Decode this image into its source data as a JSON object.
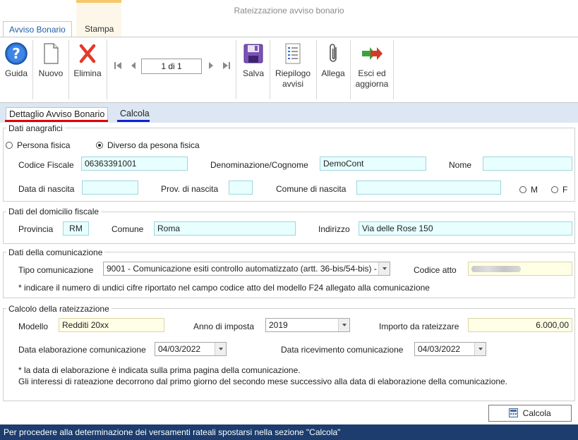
{
  "window": {
    "title": "Rateizzazione avviso bonario"
  },
  "ribbon": {
    "tabs": [
      {
        "label": "Avviso Bonario"
      },
      {
        "label": "Stampa"
      }
    ],
    "buttons": {
      "guida": "Guida",
      "nuovo": "Nuovo",
      "elimina": "Elimina",
      "salva": "Salva",
      "riepilogo_1": "Riepilogo",
      "riepilogo_2": "avvisi",
      "allega": "Allega",
      "esci_1": "Esci ed",
      "esci_2": "aggiorna"
    },
    "navigator": {
      "value": "1 di 1"
    }
  },
  "tabs": [
    {
      "label": "Dettaglio Avviso Bonario"
    },
    {
      "label": "Calcola"
    }
  ],
  "anagrafici": {
    "title": "Dati anagrafici",
    "radio_persona": "Persona fisica",
    "radio_diverso": "Diverso da pesona fisica",
    "codice_fiscale_label": "Codice Fiscale",
    "codice_fiscale": "06363391001",
    "denominazione_label": "Denominazione/Cognome",
    "denominazione": "DemoCont",
    "nome_label": "Nome",
    "nome": "",
    "data_nascita_label": "Data di nascita",
    "data_nascita": "",
    "prov_nascita_label": "Prov. di nascita",
    "prov_nascita": "",
    "comune_nascita_label": "Comune di nascita",
    "comune_nascita": "",
    "sesso_m": "M",
    "sesso_f": "F"
  },
  "domicilio": {
    "title": "Dati del domicilio fiscale",
    "provincia_label": "Provincia",
    "provincia": "RM",
    "comune_label": "Comune",
    "comune": "Roma",
    "indirizzo_label": "Indirizzo",
    "indirizzo": "Via delle Rose 150"
  },
  "comunicazione": {
    "title": "Dati della comunicazione",
    "tipo_label": "Tipo comunicazione",
    "tipo": "9001 - Comunicazione esiti controllo automatizzato (artt. 36-bis/54-bis) -",
    "codice_atto_label": "Codice atto",
    "note": "* indicare il numero di undici cifre riportato nel campo codice atto del modello F24 allegato alla comunicazione"
  },
  "rateizzazione": {
    "title": "Calcolo della rateizzazione",
    "modello_label": "Modello",
    "modello": "Redditi 20xx",
    "anno_label": "Anno di imposta",
    "anno": "2019",
    "importo_label": "Importo da rateizzare",
    "importo": "6.000,00",
    "data_elab_label": "Data elaborazione comunicazione",
    "data_elab": "04/03/2022",
    "data_ric_label": "Data ricevimento comunicazione",
    "data_ric": "04/03/2022",
    "note_1": "* la data di elaborazione è indicata sulla prima pagina della comunicazione.",
    "note_2": "Gli interessi di rateazione decorrono dal primo giorno del secondo mese successivo alla data di elaborazione della comunicazione."
  },
  "calcola_button": "Calcola",
  "status": "Per procedere alla determinazione dei versamenti rateali spostarsi nella sezione \"Calcola\"",
  "colors": {
    "status_bar": "#1c3d6e",
    "field_cyan": "#e8ffff",
    "field_yellow": "#ffffe6",
    "tab_underline_red": "#e00000",
    "tab_underline_blue": "#1020d0"
  }
}
